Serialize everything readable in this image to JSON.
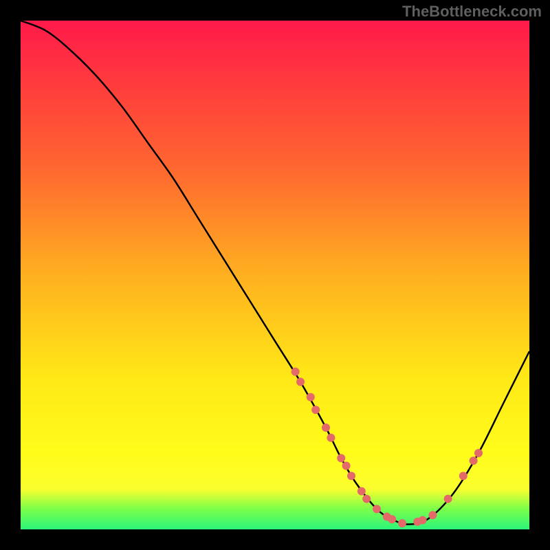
{
  "attribution": "TheBottleneck.com",
  "chart_data": {
    "type": "line",
    "title": "",
    "xlabel": "",
    "ylabel": "",
    "xlim": [
      0,
      100
    ],
    "ylim": [
      0,
      100
    ],
    "grid": false,
    "series": [
      {
        "name": "bottleneck-curve",
        "x": [
          0,
          5,
          10,
          15,
          20,
          25,
          30,
          35,
          40,
          45,
          50,
          55,
          60,
          63,
          66,
          70,
          73,
          76,
          80,
          85,
          90,
          95,
          100
        ],
        "y": [
          100,
          98,
          94,
          89,
          83,
          76,
          69,
          61,
          53,
          45,
          37,
          29,
          20,
          14,
          9,
          4,
          2,
          1,
          2,
          7,
          15,
          25,
          35
        ],
        "color": "#000000"
      }
    ],
    "highlight_dots": {
      "color": "#e46a6a",
      "radius": 6,
      "points": [
        {
          "x": 54,
          "y": 31
        },
        {
          "x": 55,
          "y": 29
        },
        {
          "x": 57,
          "y": 26
        },
        {
          "x": 58,
          "y": 23.5
        },
        {
          "x": 60,
          "y": 20
        },
        {
          "x": 61,
          "y": 18
        },
        {
          "x": 63,
          "y": 14
        },
        {
          "x": 64,
          "y": 12.5
        },
        {
          "x": 65,
          "y": 10.5
        },
        {
          "x": 67,
          "y": 7.5
        },
        {
          "x": 68,
          "y": 6
        },
        {
          "x": 70,
          "y": 4
        },
        {
          "x": 72,
          "y": 2.5
        },
        {
          "x": 73,
          "y": 2
        },
        {
          "x": 75,
          "y": 1.2
        },
        {
          "x": 78,
          "y": 1.5
        },
        {
          "x": 79,
          "y": 1.8
        },
        {
          "x": 81,
          "y": 2.8
        },
        {
          "x": 84,
          "y": 6
        },
        {
          "x": 87,
          "y": 10.5
        },
        {
          "x": 89,
          "y": 13.5
        },
        {
          "x": 90,
          "y": 15
        }
      ]
    },
    "gradient_stops": [
      {
        "pos": 0,
        "color": "#ff1a4b"
      },
      {
        "pos": 12,
        "color": "#ff3a3d"
      },
      {
        "pos": 30,
        "color": "#ff6a2f"
      },
      {
        "pos": 50,
        "color": "#ffb020"
      },
      {
        "pos": 70,
        "color": "#ffe817"
      },
      {
        "pos": 85,
        "color": "#fffc1a"
      },
      {
        "pos": 92,
        "color": "#fcff2e"
      },
      {
        "pos": 96,
        "color": "#7bff4a"
      },
      {
        "pos": 100,
        "color": "#2bf57a"
      }
    ]
  }
}
